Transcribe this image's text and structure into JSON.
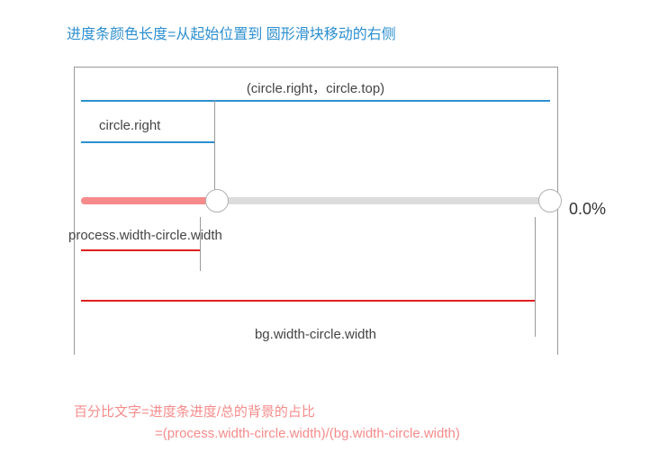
{
  "title_top": "进度条颜色长度=从起始位置到 圆形滑块移动的右侧",
  "annotations": {
    "circle_top": "(circle.right，circle.top)",
    "circle_right": "circle.right",
    "process_width": "process.width-circle.width",
    "bg_width": "bg.width-circle.width"
  },
  "slider": {
    "percent_text": "0.0%",
    "percent_value": 0.0
  },
  "formula": {
    "line1": "百分比文字=进度条进度/总的背景的占比",
    "line2": "=(process.width-circle.width)/(bg.width-circle.width)"
  },
  "colors": {
    "blue": "#2c8fd0",
    "pink_fill": "#f78b8b",
    "red": "#e02020",
    "track": "#dcdcdc"
  }
}
